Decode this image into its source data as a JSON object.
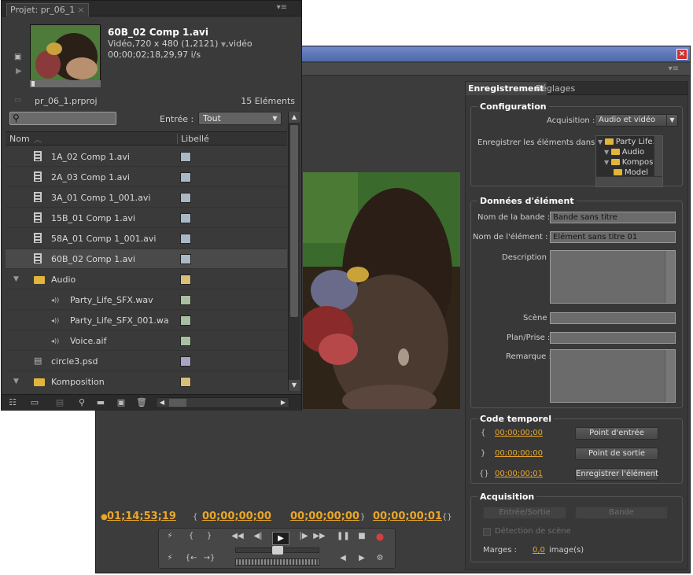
{
  "project": {
    "tab_label": "Projet: pr_06_1",
    "clip": {
      "name": "60B_02 Comp 1.avi",
      "info": "Vidéo,720 x 480 (1,2121)",
      "info_suffix": ",vidéo",
      "rate": "00;00;02;18,29,97 i/s"
    },
    "file": "pr_06_1.prproj",
    "count": "15 Eléments",
    "search": {
      "placeholder": ""
    },
    "entree_label": "Entrée :",
    "entree_value": "Tout",
    "col_name": "Nom",
    "col_label": "Libellé",
    "items": [
      {
        "name": "1A_02 Comp 1.avi",
        "type": "video",
        "color": "#a9b8c4"
      },
      {
        "name": "2A_03 Comp 1.avi",
        "type": "video",
        "color": "#a9b8c4"
      },
      {
        "name": "3A_01 Comp 1_001.avi",
        "type": "video",
        "color": "#a9b8c4"
      },
      {
        "name": "15B_01 Comp 1.avi",
        "type": "video",
        "color": "#a9b8c4"
      },
      {
        "name": "58A_01 Comp 1_001.avi",
        "type": "video",
        "color": "#a9b8c4"
      },
      {
        "name": "60B_02 Comp 1.avi",
        "type": "video",
        "color": "#a9b8c4",
        "selected": true
      },
      {
        "name": "Audio",
        "type": "folder",
        "color": "#d9c07a"
      },
      {
        "name": "Party_Life_SFX.wav",
        "type": "audio",
        "color": "#a9bfa2"
      },
      {
        "name": "Party_Life_SFX_001.wa",
        "type": "audio",
        "color": "#a9bfa2"
      },
      {
        "name": "Voice.aif",
        "type": "audio",
        "color": "#a9bfa2"
      },
      {
        "name": "circle3.psd",
        "type": "image",
        "color": "#a9a4c4"
      },
      {
        "name": "Komposition",
        "type": "folder",
        "color": "#d9c07a"
      }
    ]
  },
  "capture": {
    "tabs": {
      "recording": "Enregistrement",
      "settings": "Réglages"
    },
    "configuration": {
      "title": "Configuration",
      "acquisition_label": "Acquisition :",
      "acquisition_value": "Audio et vidéo",
      "save_in_label": "Enregistrer les éléments dans :",
      "tree": [
        "Party Life.p",
        "Audio",
        "Kompositi",
        "Model"
      ]
    },
    "element": {
      "title": "Données d'élément",
      "tape_label": "Nom de la bande :",
      "tape_value": "Bande sans titre",
      "clip_label": "Nom de l'élément :",
      "clip_value": "Elément sans titre 01",
      "desc_label": "Description :",
      "scene_label": "Scène :",
      "shot_label": "Plan/Prise :",
      "note_label": "Remarque :"
    },
    "timecode": {
      "title": "Code temporel",
      "in": "00;00;00;00",
      "out": "00;00;00;00",
      "dur": "00;00;00;01",
      "btn_in": "Point d'entrée",
      "btn_out": "Point de sortie",
      "btn_save": "Enregistrer l'élément"
    },
    "acquisition": {
      "title": "Acquisition",
      "btn_inout": "Entrée/Sortie",
      "btn_tape": "Bande",
      "scene_detect": "Détection de scène",
      "margins_label": "Marges :",
      "margins_value": "0,0",
      "margins_unit": "image(s)"
    },
    "transport_timecodes": {
      "current": "01;14;53;19",
      "in": "00;00;00;00",
      "out": "00;00;00;00",
      "duration": "00;00;00;01"
    }
  }
}
